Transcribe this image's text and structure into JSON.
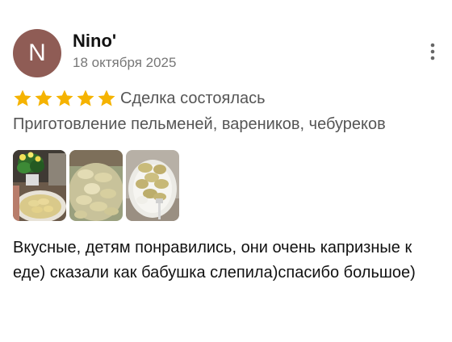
{
  "author": {
    "initial": "N",
    "name": "Nino'",
    "avatar_color": "#8f5c55"
  },
  "review": {
    "date": "18 октября 2025",
    "rating": 5,
    "rating_max": 5,
    "star_color": "#f5b301",
    "status": "Сделка состоялась",
    "service": "Приготовление пельменей, вареников, чебуреков",
    "text": "Вкусные, детям понравились, они очень капризные к еде) сказали как бабушка слепила)спасибо большое)"
  },
  "icons": {
    "menu": "more-vertical-icon",
    "star": "star-icon"
  }
}
